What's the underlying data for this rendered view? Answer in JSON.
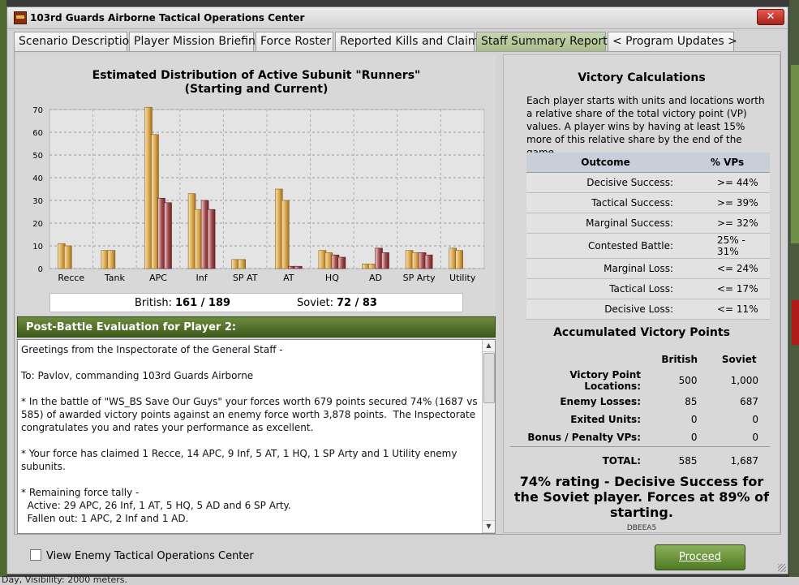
{
  "window": {
    "title": "103rd Guards Airborne Tactical Operations Center",
    "close_label": "✕"
  },
  "tabs": [
    {
      "label": "Scenario Description"
    },
    {
      "label": "Player Mission Briefing"
    },
    {
      "label": "Force Roster"
    },
    {
      "label": "Reported Kills and Claims"
    },
    {
      "label": "Staff Summary Report",
      "active": true
    },
    {
      "label": "< Program Updates >"
    }
  ],
  "chart": {
    "title_line1": "Estimated Distribution of Active Subunit \"Runners\"",
    "title_line2": "(Starting and Current)"
  },
  "chart_data": {
    "type": "bar",
    "title": "Estimated Distribution of Active Subunit \"Runners\" (Starting and Current)",
    "categories": [
      "Recce",
      "Tank",
      "APC",
      "Inf",
      "SP AT",
      "AT",
      "HQ",
      "AD",
      "SP Arty",
      "Utility"
    ],
    "series": [
      {
        "name": "British (Starting)",
        "values": [
          11,
          8,
          71,
          33,
          4,
          35,
          8,
          2,
          8,
          9
        ]
      },
      {
        "name": "British (Current)",
        "values": [
          10,
          8,
          59,
          26,
          4,
          30,
          7,
          2,
          7,
          8
        ]
      },
      {
        "name": "Soviet (Starting)",
        "values": [
          0,
          0,
          31,
          30,
          0,
          1,
          6,
          9,
          7,
          0
        ]
      },
      {
        "name": "Soviet (Current)",
        "values": [
          0,
          0,
          29,
          26,
          0,
          1,
          5,
          7,
          6,
          0
        ]
      }
    ],
    "ylim": [
      0,
      70
    ],
    "yticks": [
      0,
      10,
      20,
      30,
      40,
      50,
      60,
      70
    ],
    "colors": {
      "british": "#d9a64a",
      "soviet": "#a24a4e"
    }
  },
  "totals": {
    "british_label": "British:",
    "british_value": "161 / 189",
    "soviet_label": "Soviet:",
    "soviet_value": "72 / 83"
  },
  "evaluation": {
    "header": "Post-Battle Evaluation for Player 2:",
    "text": "Greetings from the Inspectorate of the General Staff -\n\nTo: Pavlov, commanding 103rd Guards Airborne\n\n* In the battle of \"WS_BS Save Our Guys\" your forces worth 679 points secured 74% (1687 vs 585) of awarded victory points against an enemy force worth 3,878 points.  The Inspectorate congratulates you and rates your performance as excellent.\n\n* Your force has claimed 1 Recce, 14 APC, 9 Inf, 5 AT, 1 HQ, 1 SP Arty and 1 Utility enemy subunits.\n\n* Remaining force tally -\n  Active: 29 APC, 26 Inf, 1 AT, 5 HQ, 5 AD and 6 SP Arty.\n  Fallen out: 1 APC, 2 Inf and 1 AD."
  },
  "victory": {
    "title": "Victory Calculations",
    "description": "Each player starts with units and locations worth a relative share of the total victory point (VP) values. A player wins by having at least 15% more of this relative share by the end of the game.",
    "col_outcome": "Outcome",
    "col_vps": "% VPs",
    "rows": [
      {
        "outcome": "Decisive Success:",
        "vps": ">= 44%"
      },
      {
        "outcome": "Tactical Success:",
        "vps": ">= 39%"
      },
      {
        "outcome": "Marginal Success:",
        "vps": ">= 32%"
      },
      {
        "outcome": "Contested Battle:",
        "vps": "25% - 31%"
      },
      {
        "outcome": "Marginal Loss:",
        "vps": "<= 24%"
      },
      {
        "outcome": "Tactical Loss:",
        "vps": "<= 17%"
      },
      {
        "outcome": "Decisive Loss:",
        "vps": "<= 11%"
      }
    ]
  },
  "accumulated": {
    "title": "Accumulated Victory Points",
    "col_british": "British",
    "col_soviet": "Soviet",
    "rows": [
      {
        "label": "Victory Point Locations:",
        "british": "500",
        "soviet": "1,000"
      },
      {
        "label": "Enemy Losses:",
        "british": "85",
        "soviet": "687"
      },
      {
        "label": "Exited Units:",
        "british": "0",
        "soviet": "0"
      },
      {
        "label": "Bonus / Penalty VPs:",
        "british": "0",
        "soviet": "0"
      }
    ],
    "total_label": "TOTAL:",
    "total_british": "585",
    "total_soviet": "1,687",
    "rating": "74% rating - Decisive Success for the Soviet player.  Forces at 89% of starting.",
    "code": "DBEEA5"
  },
  "footer": {
    "checkbox_label": "View Enemy Tactical Operations Center",
    "proceed_label": "Proceed"
  },
  "background": {
    "status_text": "Day, Visibility: 2000 meters."
  }
}
